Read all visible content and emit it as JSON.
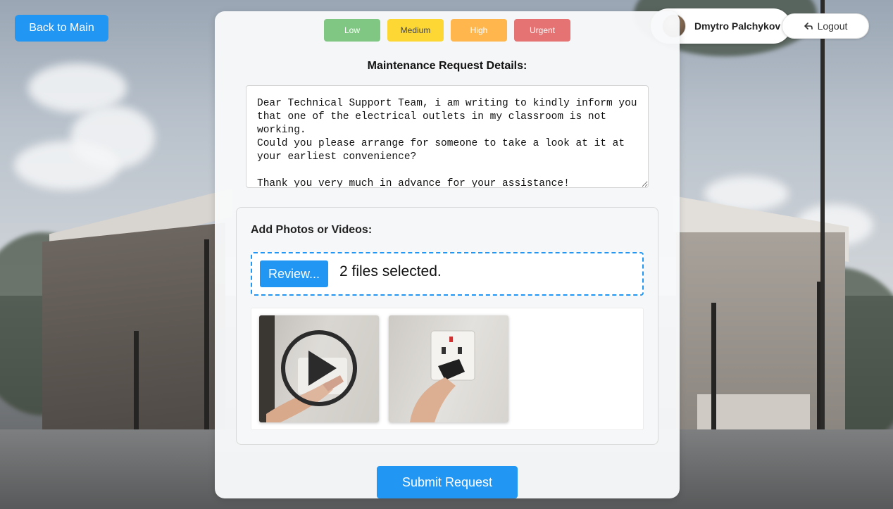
{
  "nav": {
    "back_label": "Back to Main"
  },
  "user": {
    "name": "Dmytro Palchykov",
    "logout_label": "Logout"
  },
  "priority": {
    "options": [
      "Low",
      "Medium",
      "High",
      "Urgent"
    ]
  },
  "form": {
    "details_label": "Maintenance Request Details:",
    "details_value": "Dear Technical Support Team, i am writing to kindly inform you that one of the electrical outlets in my classroom is not working.\nCould you please arrange for someone to take a look at it at your earliest convenience?\n\nThank you very much in advance for your assistance!",
    "media_title": "Add Photos or Videos:",
    "review_label": "Review...",
    "files_status": "2 files selected.",
    "submit_label": "Submit Request"
  },
  "colors": {
    "accent": "#2196f3",
    "low": "#81c784",
    "medium": "#fdd835",
    "high": "#ffb74d",
    "urgent": "#e57373"
  },
  "icons": {
    "logout": "logout-arrow-icon",
    "play": "play-icon"
  }
}
